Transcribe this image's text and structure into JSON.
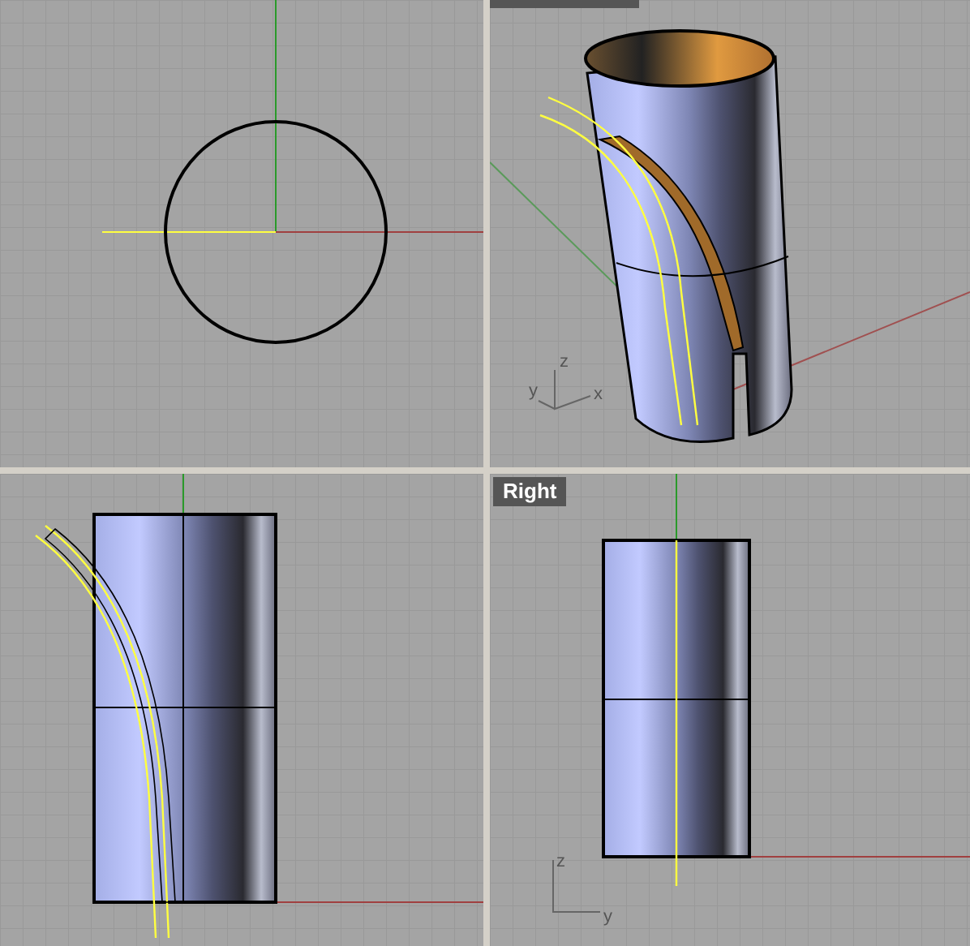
{
  "viewports": [
    {
      "kind": "top"
    },
    {
      "kind": "perspective",
      "axis_labels": [
        "z",
        "y",
        "x"
      ]
    },
    {
      "kind": "front"
    },
    {
      "kind": "right",
      "label": "Right",
      "axis_labels": [
        "z",
        "y"
      ]
    }
  ]
}
